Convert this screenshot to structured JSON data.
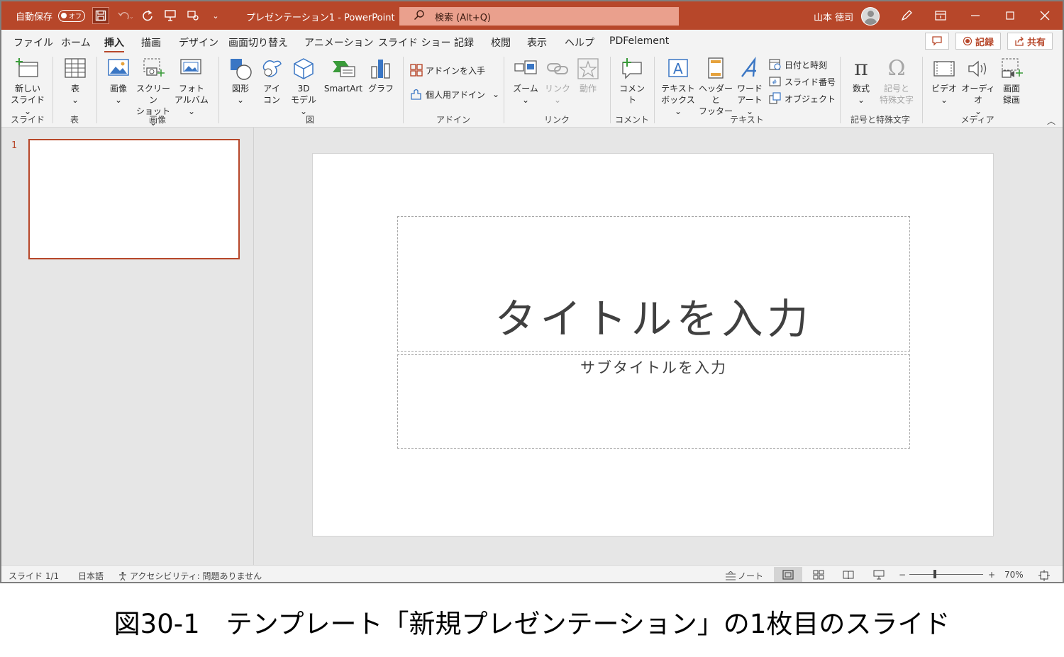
{
  "titlebar": {
    "autosave_label": "自動保存",
    "autosave_state": "オフ",
    "doc_title": "プレゼンテーション1 - PowerPoint",
    "search_text": "検索 (Alt+Q)",
    "user_name": "山本 徳司"
  },
  "tabs": [
    "ファイル",
    "ホーム",
    "挿入",
    "描画",
    "デザイン",
    "画面切り替え",
    "アニメーション",
    "スライド ショー",
    "記録",
    "校閲",
    "表示",
    "ヘルプ",
    "PDFelement"
  ],
  "active_tab": "挿入",
  "tab_actions": {
    "record": "記録",
    "share": "共有"
  },
  "ribbon": {
    "new_slide": [
      "新しい",
      "スライド ⌄"
    ],
    "table": [
      "表",
      "⌄"
    ],
    "image": [
      "画像",
      "⌄"
    ],
    "screenshot": [
      "スクリーン",
      "ショット ⌄"
    ],
    "photo_album": [
      "フォト",
      "アルバム ⌄"
    ],
    "shapes": [
      "図形",
      "⌄"
    ],
    "icons": [
      "アイ",
      "コン"
    ],
    "model3d": [
      "3D",
      "モデル ⌄"
    ],
    "smartart": "SmartArt",
    "chart": "グラフ",
    "get_addins": "アドインを入手",
    "my_addins": "個人用アドイン",
    "zoom": [
      "ズーム",
      "⌄"
    ],
    "link": [
      "リンク",
      "⌄"
    ],
    "action": "動作",
    "comment": "コメント",
    "textbox": [
      "テキスト",
      "ボックス ⌄"
    ],
    "header_footer": [
      "ヘッダーと",
      "フッター"
    ],
    "wordart": [
      "ワード",
      "アート ⌄"
    ],
    "datetime": "日付と時刻",
    "slide_number": "スライド番号",
    "object": "オブジェクト",
    "equation": [
      "数式",
      "⌄"
    ],
    "symbol": [
      "記号と",
      "特殊文字"
    ],
    "video": [
      "ビデオ",
      "⌄"
    ],
    "audio": [
      "オーディオ",
      "⌄"
    ],
    "screen_record": [
      "画面",
      "録画"
    ],
    "groups": {
      "slides": "スライド",
      "tables": "表",
      "images": "画像",
      "illustrations": "図",
      "addins": "アドイン",
      "links": "リンク",
      "comments": "コメント",
      "text": "テキスト",
      "symbols": "記号と特殊文字",
      "media": "メディア"
    }
  },
  "thumbnails": {
    "slide_number": "1"
  },
  "slide": {
    "title_placeholder": "タイトルを入力",
    "subtitle_placeholder": "サブタイトルを入力"
  },
  "status": {
    "slide_info": "スライド 1/1",
    "language": "日本語",
    "accessibility": "アクセシビリティ: 問題ありません",
    "notes": "ノート",
    "zoom_minus": "−",
    "zoom_plus": "+",
    "zoom_level": "70%"
  },
  "caption": "図30-1　テンプレート「新規プレゼンテーション」の1枚目のスライド",
  "colors": {
    "accent": "#b7472a",
    "ribbon_bg": "#f3f3f3",
    "canvas_bg": "#e6e6e6"
  }
}
